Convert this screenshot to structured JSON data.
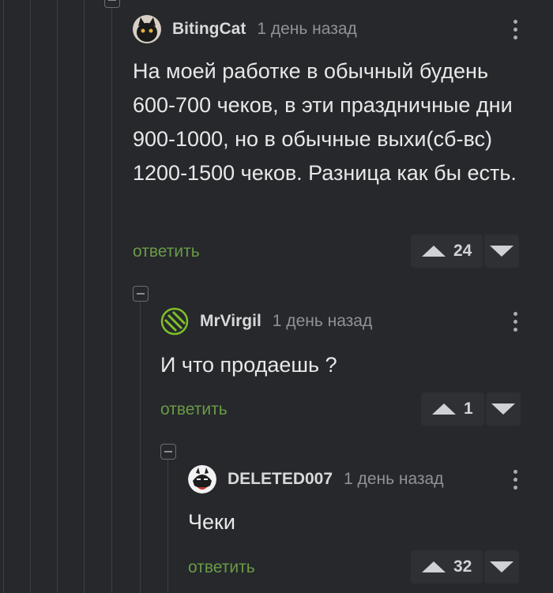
{
  "colors": {
    "background": "#26282c",
    "reply": "#6a9a46",
    "meta": "#8f9297"
  },
  "comments": [
    {
      "author": "BitingCat",
      "time": "1 день назад",
      "text": "На моей работке в обычный будень 600-700 чеков, в эти праздничные дни 900-1000, но в обычные выхи(сб-вс) 1200-1500 чеков. Разница как бы есть.",
      "reply": "ответить",
      "score": "24"
    },
    {
      "author": "MrVirgil",
      "time": "1 день назад",
      "text": "И что продаешь ?",
      "reply": "ответить",
      "score": "1"
    },
    {
      "author": "DELETED007",
      "time": "1 день назад",
      "text": "Чеки",
      "reply": "ответить",
      "score": "32"
    }
  ],
  "icons": {
    "up": "triangle-up",
    "down": "triangle-down",
    "menu": "kebab-menu",
    "collapse": "minus-square"
  }
}
